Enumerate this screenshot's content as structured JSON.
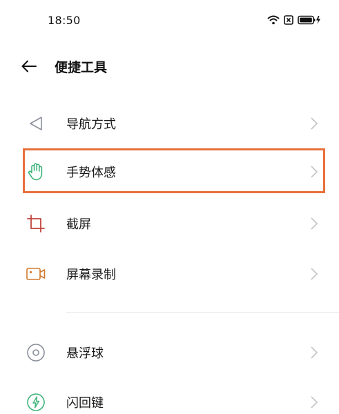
{
  "status_bar": {
    "time": "18:50",
    "icons": [
      "wifi-icon",
      "sim-blocked-icon",
      "battery-charging-icon"
    ]
  },
  "header": {
    "back_icon": "arrow-left-icon",
    "title": "便捷工具"
  },
  "items": [
    {
      "label": "导航方式",
      "icon": "navigation-triangle-icon",
      "icon_color": "#8a8f9a"
    },
    {
      "label": "手势体感",
      "icon": "hand-gesture-icon",
      "icon_color": "#3db37a",
      "highlighted": true
    },
    {
      "label": "截屏",
      "icon": "crop-screenshot-icon",
      "icon_color": "#c0433a"
    },
    {
      "label": "屏幕录制",
      "icon": "screen-record-camera-icon",
      "icon_color": "#d2782c"
    },
    {
      "label": "悬浮球",
      "icon": "floating-ball-icon",
      "icon_color": "#8a8f9a"
    },
    {
      "label": "闪回键",
      "icon": "flashback-key-icon",
      "icon_color": "#3db37a"
    }
  ],
  "colors": {
    "highlight_border": "#e8703a",
    "chevron": "#c4c4c4",
    "text": "#1a1a1a"
  }
}
